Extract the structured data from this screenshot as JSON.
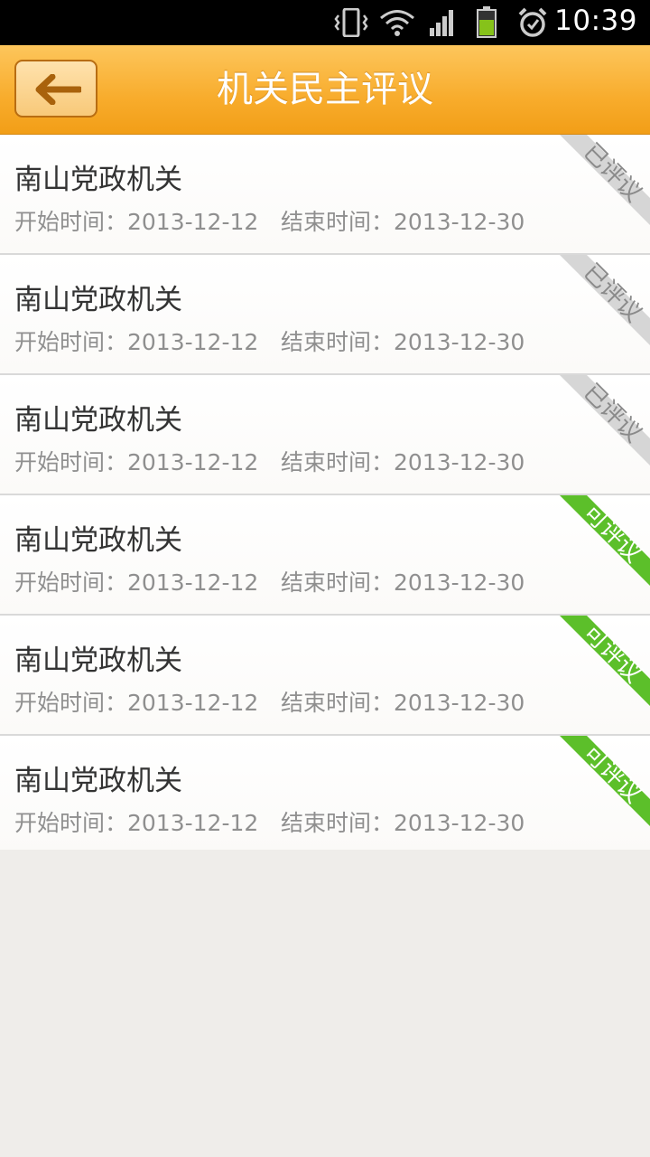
{
  "status_bar": {
    "time": "10:39",
    "icons": [
      "vibrate-icon",
      "wifi-icon",
      "signal-icon",
      "battery-icon",
      "alarm-icon"
    ]
  },
  "header": {
    "title": "机关民主评议",
    "back_icon": "back-arrow-icon",
    "color_top": "#fdc65c",
    "color_bottom": "#f29e17"
  },
  "list": {
    "items": [
      {
        "name": "南山党政机关",
        "start": "开始时间：2013-12-12",
        "end": "结束时间：2013-12-30",
        "status": "已评议",
        "state": "done"
      },
      {
        "name": "南山党政机关",
        "start": "开始时间：2013-12-12",
        "end": "结束时间：2013-12-30",
        "status": "已评议",
        "state": "done"
      },
      {
        "name": "南山党政机关",
        "start": "开始时间：2013-12-12",
        "end": "结束时间：2013-12-30",
        "status": "已评议",
        "state": "done"
      },
      {
        "name": "南山党政机关",
        "start": "开始时间：2013-12-12",
        "end": "结束时间：2013-12-30",
        "status": "可评议",
        "state": "open"
      },
      {
        "name": "南山党政机关",
        "start": "开始时间：2013-12-12",
        "end": "结束时间：2013-12-30",
        "status": "可评议",
        "state": "open"
      },
      {
        "name": "南山党政机关",
        "start": "开始时间：2013-12-12",
        "end": "结束时间：2013-12-30",
        "status": "可评议",
        "state": "open"
      }
    ]
  },
  "colors": {
    "ribbon_done": "#d6d6d6",
    "ribbon_open": "#5cbf2a"
  }
}
